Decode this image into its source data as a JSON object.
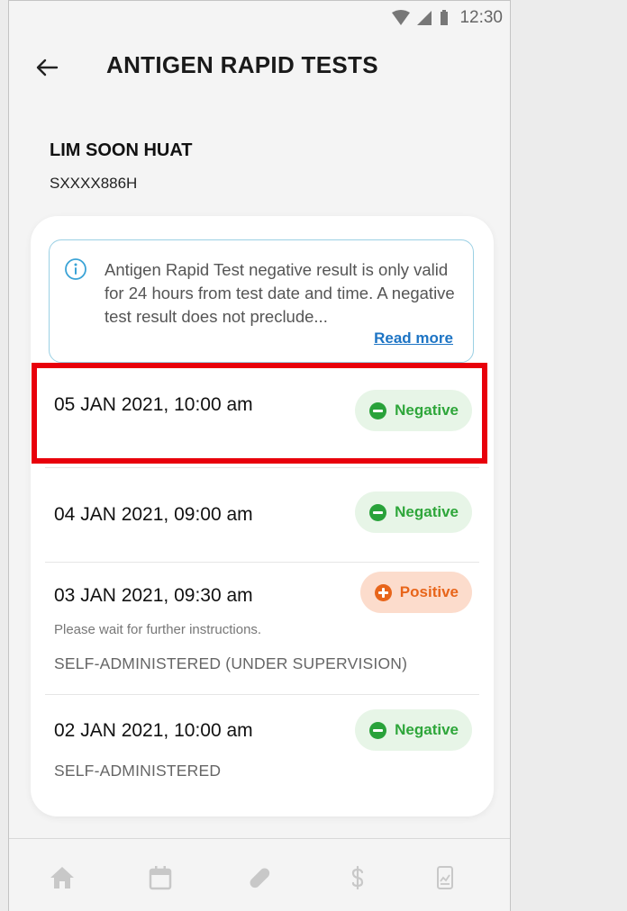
{
  "status_bar": {
    "time": "12:30"
  },
  "header": {
    "title": "ANTIGEN RAPID TESTS"
  },
  "profile": {
    "name": "LIM SOON HUAT",
    "id": "SXXXX886H"
  },
  "notice": {
    "text": "Antigen Rapid Test negative result is only valid for 24 hours from test date and time. A negative test result does not preclude...",
    "read_more": "Read more"
  },
  "tests": [
    {
      "date": "05 JAN 2021, 10:00 am",
      "result": "Negative",
      "note": "",
      "admin": ""
    },
    {
      "date": "04 JAN 2021, 09:00 am",
      "result": "Negative",
      "note": "",
      "admin": ""
    },
    {
      "date": "03 JAN 2021, 09:30 am",
      "result": "Positive",
      "note": "Please wait for further instructions.",
      "admin": "SELF-ADMINISTERED (UNDER SUPERVISION)"
    },
    {
      "date": "02 JAN 2021, 10:00 am",
      "result": "Negative",
      "note": "",
      "admin": "SELF-ADMINISTERED"
    }
  ],
  "colors": {
    "negative": "#29a23a",
    "positive": "#e8651a",
    "link": "#1d74c4",
    "highlight": "#e8000b"
  },
  "bottom_nav": [
    "home-icon",
    "calendar-icon",
    "pill-icon",
    "dollar-icon",
    "document-chart-icon"
  ]
}
